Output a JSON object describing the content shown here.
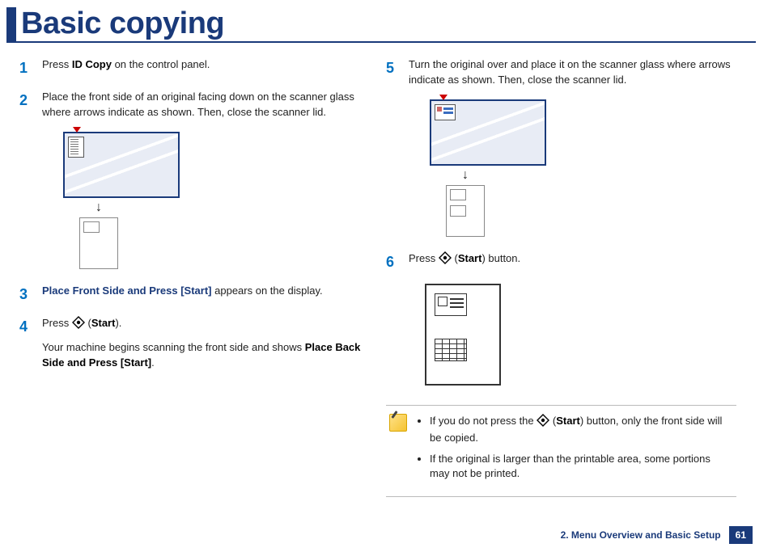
{
  "title": "Basic copying",
  "steps": {
    "s1": {
      "pre": "Press ",
      "bold": "ID Copy",
      "post": " on the control panel."
    },
    "s2": "Place the front side of an original facing down on the scanner glass where arrows indicate as shown. Then, close the scanner lid.",
    "s3": {
      "bold": "Place Front Side and Press [Start]",
      "post": " appears on the display."
    },
    "s4": {
      "line1_pre": "Press ",
      "line1_paren_open": "(",
      "line1_bold": "Start",
      "line1_paren_close": ").",
      "line2_pre": "Your machine begins scanning the front side and shows ",
      "line2_bold": "Place Back Side and Press [Start]",
      "line2_post": "."
    },
    "s5": "Turn the original over and place it on the scanner glass where arrows indicate as shown. Then, close the scanner lid.",
    "s6": {
      "pre": "Press ",
      "paren_open": "(",
      "bold": "Start",
      "paren_close": ") button."
    }
  },
  "notes": {
    "n1": {
      "pre": "If you do not press the ",
      "paren_open": "(",
      "bold": "Start",
      "paren_close": ") button, only the front side will be copied."
    },
    "n2": "If the original is larger than the printable area, some portions may not be printed."
  },
  "footer": {
    "section": "2. Menu Overview and Basic Setup",
    "page": "61"
  }
}
